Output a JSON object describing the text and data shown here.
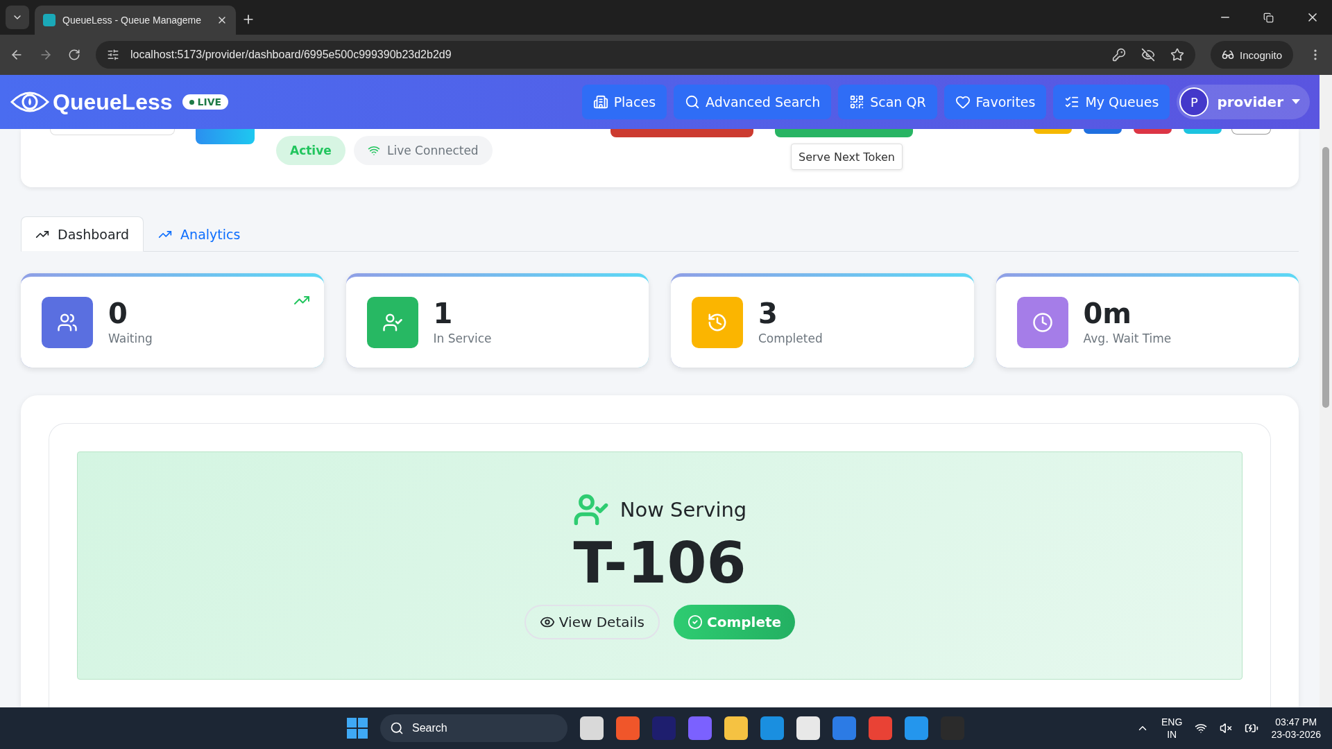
{
  "browser": {
    "tab_title": "QueueLess - Queue Manageme",
    "url": "localhost:5173/provider/dashboard/6995e500c999390b23d2b2d9",
    "profile": "Incognito"
  },
  "navbar": {
    "brand": "QueueLess",
    "badge": "LIVE",
    "links": [
      {
        "label": "Places",
        "kind": "places"
      },
      {
        "label": "Advanced Search",
        "kind": "search"
      },
      {
        "label": "Scan QR",
        "kind": "qr"
      },
      {
        "label": "Favorites",
        "kind": "favorites"
      },
      {
        "label": "My Queues",
        "kind": "queues"
      }
    ],
    "user": {
      "initial": "P",
      "name": "provider"
    }
  },
  "status": {
    "pills": [
      {
        "label": "Active",
        "kind": "status"
      },
      {
        "label": "Live Connected",
        "kind": "connection"
      }
    ],
    "tooltip": "Serve Next Token"
  },
  "tabs": [
    {
      "label": "Dashboard",
      "selected": true
    },
    {
      "label": "Analytics",
      "selected": false
    }
  ],
  "stats": [
    {
      "value": "0",
      "label": "Waiting",
      "kind": "users",
      "color": "#5a6fe0",
      "trend": true
    },
    {
      "value": "1",
      "label": "In Service",
      "kind": "user-check",
      "color": "#27b863",
      "trend": false
    },
    {
      "value": "3",
      "label": "Completed",
      "kind": "history",
      "color": "#fbb500",
      "trend": false
    },
    {
      "value": "0m",
      "label": "Avg. Wait Time",
      "kind": "clock",
      "color": "#a57de8",
      "trend": false
    }
  ],
  "now_serving": {
    "heading": "Now Serving",
    "token": "T-106",
    "buttons": [
      {
        "label": "View Details",
        "kind": "details"
      },
      {
        "label": "Complete",
        "kind": "complete"
      }
    ]
  },
  "taskbar": {
    "search": "Search",
    "language": "ENG",
    "region": "IN",
    "time": "03:47 PM",
    "date": "23-03-2026"
  }
}
